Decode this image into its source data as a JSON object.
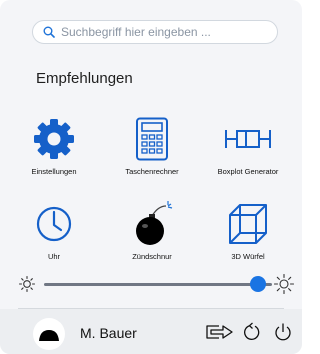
{
  "search": {
    "placeholder": "Suchbegriff hier eingeben ..."
  },
  "section": {
    "title": "Empfehlungen"
  },
  "apps": [
    {
      "label": "Einstellungen",
      "icon": "gear-icon"
    },
    {
      "label": "Taschenrechner",
      "icon": "calculator-icon"
    },
    {
      "label": "Boxplot Generator",
      "icon": "boxplot-icon"
    },
    {
      "label": "Uhr",
      "icon": "clock-icon"
    },
    {
      "label": "Zündschnur",
      "icon": "bomb-icon"
    },
    {
      "label": "3D Würfel",
      "icon": "cube-icon"
    }
  ],
  "brightness": {
    "level": 0.94
  },
  "user": {
    "name": "M. Bauer"
  },
  "colors": {
    "accent": "#1a74e3",
    "icon": "#1560c9"
  }
}
